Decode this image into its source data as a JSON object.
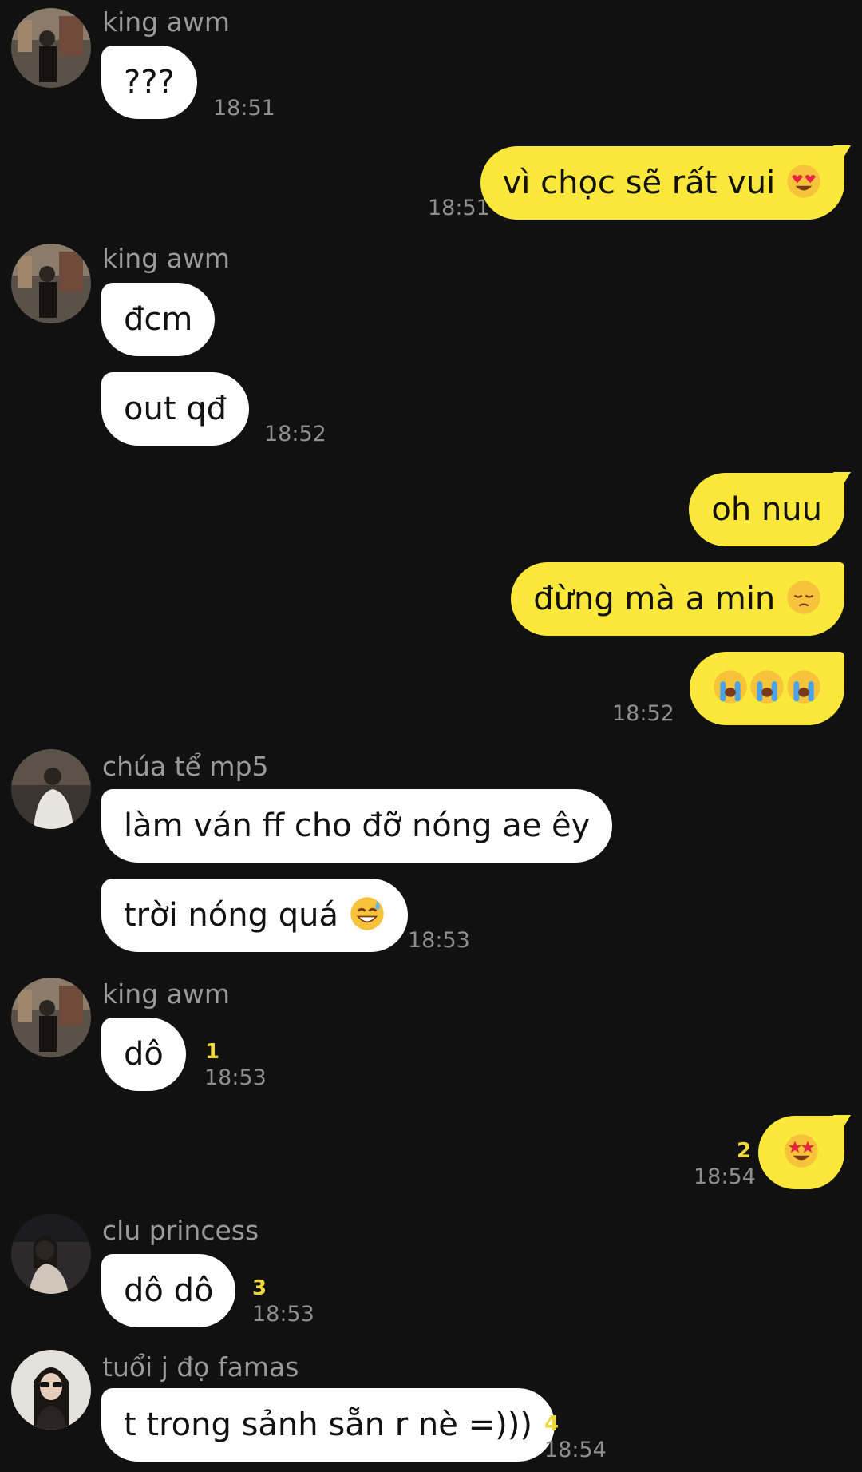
{
  "messages": [
    {
      "sender": "king awm",
      "avatar": "avatar-king-awm",
      "text": "???",
      "time": "18:51"
    },
    {
      "out": true,
      "text": "vì chọc sẽ rất vui",
      "emoji": "heart-eyes-emoji",
      "time": "18:51"
    },
    {
      "sender": "king awm",
      "avatar": "avatar-king-awm",
      "lines": [
        "đcm",
        "out qđ"
      ],
      "time": "18:52"
    },
    {
      "out": true,
      "lines": [
        "oh nuu",
        "đừng mà a min"
      ],
      "emoji_line2": "pensive-face-emoji",
      "emoji_line3": [
        "crying-face-emoji",
        "crying-face-emoji",
        "crying-face-emoji"
      ],
      "time": "18:52"
    },
    {
      "sender": "chúa tể mp5",
      "avatar": "avatar-chua-te-mp5",
      "lines": [
        "làm ván ff cho đỡ nóng ae êy",
        "trời nóng quá"
      ],
      "emoji": "sweat-smile-emoji",
      "time": "18:53"
    },
    {
      "sender": "king awm",
      "avatar": "avatar-king-awm",
      "text": "dô",
      "count": "1",
      "time": "18:53"
    },
    {
      "out": true,
      "emoji": "star-struck-emoji",
      "count": "2",
      "time": "18:54"
    },
    {
      "sender": "clu princess",
      "avatar": "avatar-clu-princess",
      "text": "dô dô",
      "count": "3",
      "time": "18:53"
    },
    {
      "sender": "tuổi j đọ famas",
      "avatar": "avatar-tuoi-j-do-famas",
      "text": "t trong sảnh sẵn r nè =)))",
      "count": "4",
      "time": "18:54"
    }
  ],
  "colors": {
    "background": "#111111",
    "incoming": "#ffffff",
    "outgoing": "#fbe83b",
    "count": "#f0d83a",
    "muted": "#8f8f8f"
  }
}
